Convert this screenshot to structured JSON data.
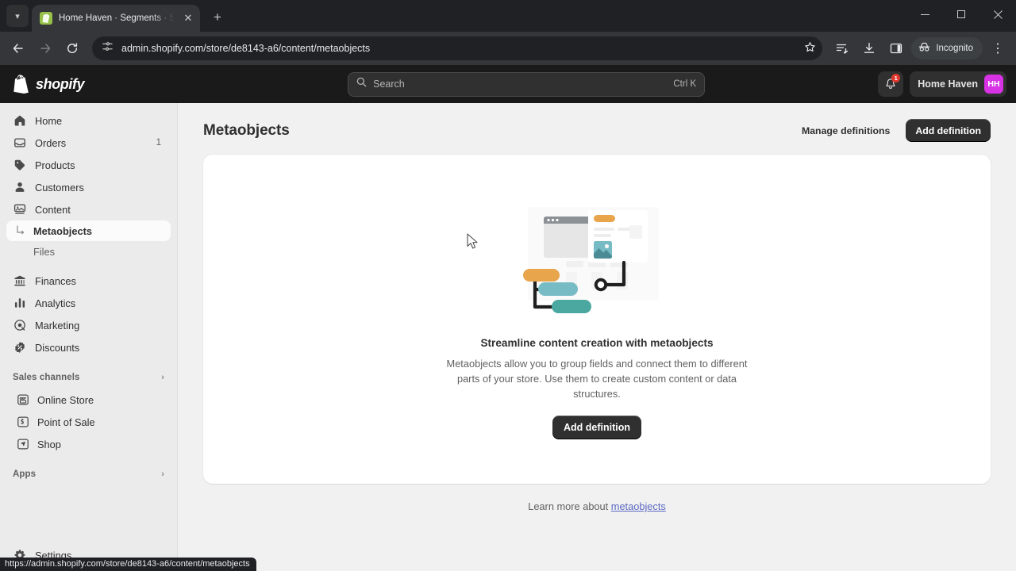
{
  "browser": {
    "tab": {
      "title": "Home Haven · Segments · Shop",
      "favicon": "shopify-bag-icon",
      "close_label": "✕",
      "new_tab_label": "+"
    },
    "tab_list_chevron": "▾",
    "nav": {
      "back": "←",
      "forward": "→",
      "reload": "⟳"
    },
    "omnibox": {
      "site_settings_icon": "tune-icon",
      "url": "admin.shopify.com/store/de8143-a6/content/metaobjects",
      "bookmark_icon": "star-icon"
    },
    "toolbar_icons": [
      "reading-list-icon",
      "download-icon",
      "side-panel-icon"
    ],
    "incognito_label": "Incognito",
    "menu_icon": "⋮",
    "window_controls": {
      "minimize": "—",
      "maximize": "❐",
      "close": "✕"
    },
    "status_url": "https://admin.shopify.com/store/de8143-a6/content/metaobjects"
  },
  "topbar": {
    "brand": "shopify",
    "search": {
      "placeholder": "Search",
      "shortcut": "Ctrl K",
      "icon": "search-icon"
    },
    "notifications": {
      "icon": "bell-icon",
      "badge": "1"
    },
    "store": {
      "name": "Home Haven",
      "initials": "HH",
      "avatar_color": "#d732e3"
    }
  },
  "sidebar": {
    "items": [
      {
        "label": "Home",
        "icon": "home-icon",
        "badge": ""
      },
      {
        "label": "Orders",
        "icon": "inbox-icon",
        "badge": "1"
      },
      {
        "label": "Products",
        "icon": "tag-icon",
        "badge": ""
      },
      {
        "label": "Customers",
        "icon": "person-icon",
        "badge": ""
      },
      {
        "label": "Content",
        "icon": "content-icon",
        "badge": ""
      }
    ],
    "sub_items": [
      {
        "label": "Metaobjects",
        "active": true
      },
      {
        "label": "Files",
        "active": false
      }
    ],
    "items_after": [
      {
        "label": "Finances",
        "icon": "bank-icon",
        "badge": ""
      },
      {
        "label": "Analytics",
        "icon": "chart-icon",
        "badge": ""
      },
      {
        "label": "Marketing",
        "icon": "megaphone-icon",
        "badge": ""
      },
      {
        "label": "Discounts",
        "icon": "discount-icon",
        "badge": ""
      }
    ],
    "sales_channels": {
      "title": "Sales channels",
      "chevron": "›",
      "items": [
        {
          "label": "Online Store",
          "icon": "storefront-icon"
        },
        {
          "label": "Point of Sale",
          "icon": "pos-icon"
        },
        {
          "label": "Shop",
          "icon": "shop-icon"
        }
      ]
    },
    "apps": {
      "title": "Apps",
      "chevron": "›"
    },
    "settings": {
      "label": "Settings",
      "icon": "gear-icon"
    }
  },
  "page": {
    "title": "Metaobjects",
    "manage_definitions_label": "Manage definitions",
    "add_definition_label": "Add definition",
    "empty_state": {
      "illustration": "metaobjects-illustration",
      "title": "Streamline content creation with metaobjects",
      "body": "Metaobjects allow you to group fields and connect them to different parts of your store. Use them to create custom content or data structures.",
      "cta_label": "Add definition"
    },
    "footer": {
      "text": "Learn more about ",
      "link_label": "metaobjects"
    }
  },
  "colors": {
    "accent_dark": "#303030",
    "link": "#5c6ac4",
    "illo_orange": "#e8a54b",
    "illo_teal_light": "#77bcc4",
    "illo_teal": "#4aa8a0",
    "illo_line": "#1f1f1f"
  }
}
